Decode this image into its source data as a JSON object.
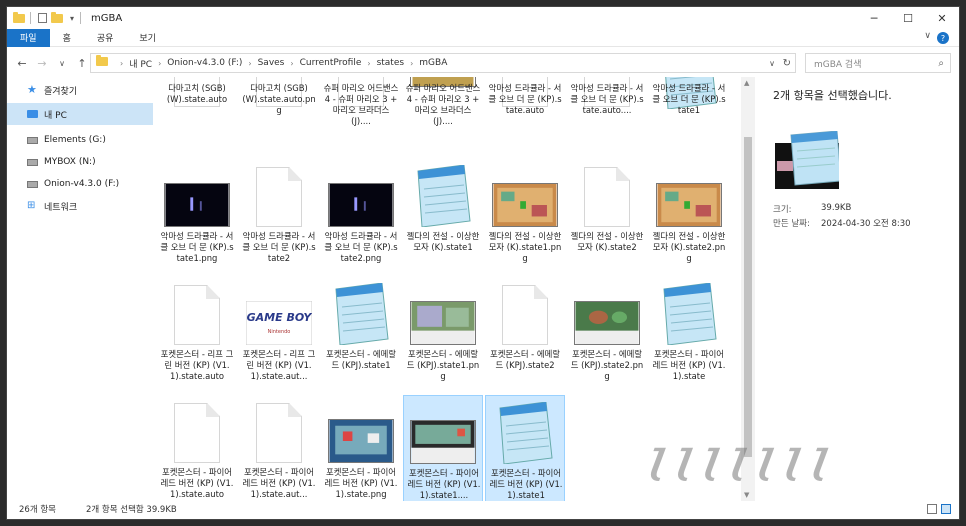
{
  "window": {
    "title": "mGBA"
  },
  "ribbon": {
    "tabs": [
      "파일",
      "홈",
      "공유",
      "보기"
    ],
    "active": 0
  },
  "address": {
    "crumbs": [
      "내 PC",
      "Onion-v4.3.0 (F:)",
      "Saves",
      "CurrentProfile",
      "states",
      "mGBA"
    ]
  },
  "search": {
    "placeholder": "mGBA 검색"
  },
  "sidebar": {
    "items": [
      {
        "label": "즐겨찾기",
        "icon": "star-icon"
      },
      {
        "label": "내 PC",
        "icon": "pc-icon",
        "selected": true
      },
      {
        "label": "Elements (G:)",
        "icon": "drive-icon"
      },
      {
        "label": "MYBOX (N:)",
        "icon": "drive-icon"
      },
      {
        "label": "Onion-v4.3.0 (F:)",
        "icon": "drive-icon"
      },
      {
        "label": "네트워크",
        "icon": "network-icon"
      }
    ]
  },
  "files": [
    {
      "label": "다마고치 (SGB) (W).state.auto",
      "type": "doc"
    },
    {
      "label": "다마고치 (SGB) (W).state.auto.png",
      "type": "doc"
    },
    {
      "label": "슈퍼 마리오 어드밴스 4 - 슈퍼 마리오 3 + 마리오 브라더스 (J)....",
      "type": "doc"
    },
    {
      "label": "슈퍼 마리오 어드밴스 4 - 슈퍼 마리오 3 + 마리오 브라더스 (J)....",
      "type": "game"
    },
    {
      "label": "악마성 드라큘라 - 서클 오브 더 문 (KP).state.auto",
      "type": "doc"
    },
    {
      "label": "악마성 드라큘라 - 서클 오브 더 문 (KP).state.auto....",
      "type": "doc"
    },
    {
      "label": "악마성 드라큘라 - 서클 오브 더 문 (KP).state1",
      "type": "note"
    },
    {
      "label": "악마성 드라큘라 - 서클 오브 더 문 (KP).state1.png",
      "type": "dark"
    },
    {
      "label": "악마성 드라큘라 - 서클 오브 더 문 (KP).state2",
      "type": "doc"
    },
    {
      "label": "악마성 드라큘라 - 서클 오브 더 문 (KP).state2.png",
      "type": "dark"
    },
    {
      "label": "젤다의 전설 - 이상한 모자 (K).state1",
      "type": "note"
    },
    {
      "label": "젤다의 전설 - 이상한 모자 (K).state1.png",
      "type": "zelda"
    },
    {
      "label": "젤다의 전설 - 이상한 모자 (K).state2",
      "type": "doc"
    },
    {
      "label": "젤다의 전설 - 이상한 모자 (K).state2.png",
      "type": "zelda"
    },
    {
      "label": "포켓몬스터 - 리프 그린 버전 (KP) (V1.1).state.auto",
      "type": "doc"
    },
    {
      "label": "포켓몬스터 - 리프 그린 버전 (KP) (V1.1).state.aut...",
      "type": "gameboy"
    },
    {
      "label": "포켓몬스터 - 에메랄드 (KPJ).state1",
      "type": "note"
    },
    {
      "label": "포켓몬스터 - 에메랄드 (KPJ).state1.png",
      "type": "poke"
    },
    {
      "label": "포켓몬스터 - 에메랄드 (KPJ).state2",
      "type": "doc"
    },
    {
      "label": "포켓몬스터 - 에메랄드 (KPJ).state2.png",
      "type": "poke2"
    },
    {
      "label": "포켓몬스터 - 파이어 레드 버전 (KP) (V1.1).state",
      "type": "note"
    },
    {
      "label": "포켓몬스터 - 파이어 레드 버전 (KP) (V1.1).state.auto",
      "type": "doc"
    },
    {
      "label": "포켓몬스터 - 파이어 레드 버전 (KP) (V1.1).state.aut...",
      "type": "doc"
    },
    {
      "label": "포켓몬스터 - 파이어 레드 버전 (KP) (V1.1).state.png",
      "type": "poke3"
    },
    {
      "label": "포켓몬스터 - 파이어 레드 버전 (KP) (V1.1).state1....",
      "type": "poke4",
      "selected": true
    },
    {
      "label": "포켓몬스터 - 파이어 레드 버전 (KP) (V1.1).state1",
      "type": "note",
      "selected": true
    }
  ],
  "details": {
    "title": "2개 항목을 선택했습니다.",
    "size_key": "크기:",
    "size_val": "39.9KB",
    "date_key": "만든 날짜:",
    "date_val": "2024-04-30 오전 8:30"
  },
  "status": {
    "count": "26개 항목",
    "selected": "2개 항목 선택함 39.9KB"
  },
  "watermark": "ꙇꙇꙇꙇꙇꙇꙇ",
  "colors": {
    "accent": "#1a73c8",
    "selection": "#cce8ff"
  }
}
